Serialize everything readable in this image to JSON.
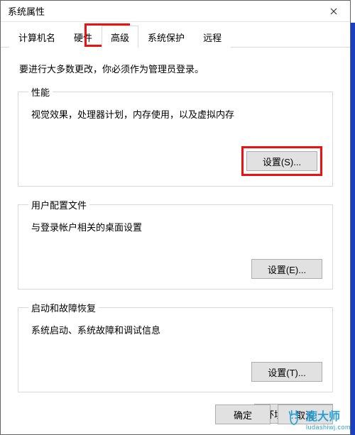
{
  "window": {
    "title": "系统属性"
  },
  "tabs": {
    "computer_name": "计算机名",
    "hardware": "硬件",
    "advanced": "高级",
    "system_protection": "系统保护",
    "remote": "远程"
  },
  "hint": "要进行大多数更改，你必须作为管理员登录。",
  "groups": {
    "performance": {
      "legend": "性能",
      "desc": "视觉效果，处理器计划，内存使用，以及虚拟内存",
      "button": "设置(S)..."
    },
    "user_profiles": {
      "legend": "用户配置文件",
      "desc": "与登录帐户相关的桌面设置",
      "button": "设置(E)..."
    },
    "startup_recovery": {
      "legend": "启动和故障恢复",
      "desc": "系统启动、系统故障和调试信息",
      "button": "设置(T)..."
    }
  },
  "env_button": "环境变量(N)...",
  "footer": {
    "ok": "确定",
    "cancel": "取消"
  },
  "watermark": {
    "text": "鹿大师",
    "sub": "ludashiwj.com"
  }
}
